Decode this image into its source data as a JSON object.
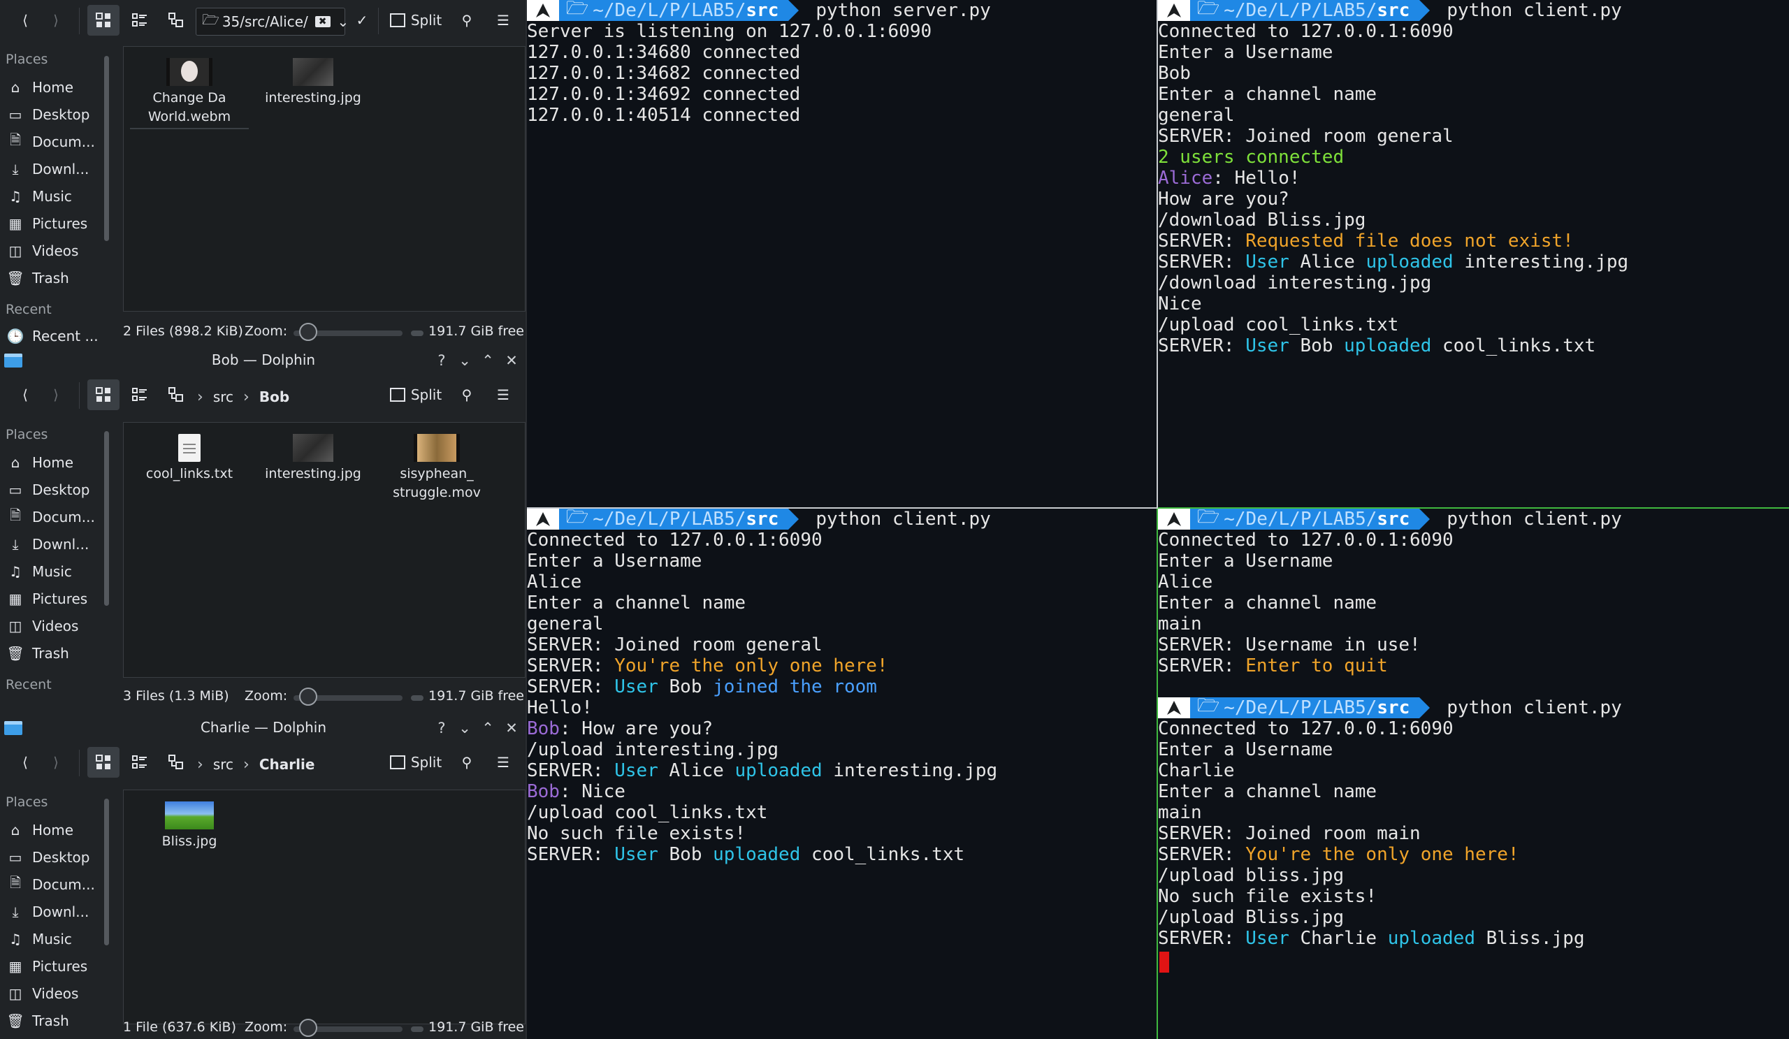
{
  "colors": {
    "terminal_bg": "#0d1117",
    "prompt_blue": "#1f88e5",
    "green": "#7ee03a",
    "purple": "#9b6bd6",
    "orange": "#f0a42a",
    "cyan": "#2fc4e8",
    "blue": "#4aa0ff",
    "cursor_red": "#e01414"
  },
  "alice_window": {
    "url": "35/src/Alice/",
    "split_label": "Split",
    "places_header": "Places",
    "recent_header": "Recent",
    "places": [
      "Home",
      "Desktop",
      "Docum...",
      "Downl...",
      "Music",
      "Pictures",
      "Videos",
      "Trash"
    ],
    "recent": [
      "Recent ..."
    ],
    "files": [
      {
        "name": "Change Da World.webm",
        "icon": "video-thumbnail"
      },
      {
        "name": "interesting.jpg",
        "icon": "image-thumbnail"
      }
    ],
    "status": {
      "count": "2 Files (898.2 KiB)",
      "zoom_label": "Zoom:",
      "free": "191.7 GiB free"
    }
  },
  "bob_window": {
    "title": "Bob — Dolphin",
    "split_label": "Split",
    "breadcrumb": [
      "src",
      "Bob"
    ],
    "places_header": "Places",
    "recent_header": "Recent",
    "places": [
      "Home",
      "Desktop",
      "Docum...",
      "Downl...",
      "Music",
      "Pictures",
      "Videos",
      "Trash"
    ],
    "files": [
      {
        "name": "cool_links.txt",
        "icon": "text-file-icon"
      },
      {
        "name": "interesting.jpg",
        "icon": "image-thumbnail"
      },
      {
        "name": "sisyphean_ struggle.mov",
        "icon": "video-thumbnail"
      }
    ],
    "status": {
      "count": "3 Files (1.3 MiB)",
      "zoom_label": "Zoom:",
      "free": "191.7 GiB free"
    }
  },
  "charlie_window": {
    "title": "Charlie — Dolphin",
    "split_label": "Split",
    "breadcrumb": [
      "src",
      "Charlie"
    ],
    "places_header": "Places",
    "places": [
      "Home",
      "Desktop",
      "Docum...",
      "Downl...",
      "Music",
      "Pictures",
      "Videos",
      "Trash"
    ],
    "files": [
      {
        "name": "Bliss.jpg",
        "icon": "image-thumbnail"
      }
    ],
    "status": {
      "count": "1 File (637.6 KiB)",
      "zoom_label": "Zoom:",
      "free": "191.7 GiB free"
    }
  },
  "prompt": {
    "arch": "arch-linux-icon",
    "folder": "folder-icon",
    "path_dim": "~/De/L/P/LAB5/",
    "path_bold": "src"
  },
  "terminals": {
    "server": {
      "command": "python server.py",
      "lines": [
        [
          {
            "t": "Server is listening on 127.0.0.1:6090"
          }
        ],
        [
          {
            "t": "127.0.0.1:34680 connected"
          }
        ],
        [
          {
            "t": "127.0.0.1:34682 connected"
          }
        ],
        [
          {
            "t": "127.0.0.1:34692 connected"
          }
        ],
        [
          {
            "t": "127.0.0.1:40514 connected"
          }
        ]
      ]
    },
    "bob": {
      "command": "python client.py",
      "lines": [
        [
          {
            "t": "Connected to 127.0.0.1:6090"
          }
        ],
        [
          {
            "t": "Enter a Username"
          }
        ],
        [
          {
            "t": "Bob"
          }
        ],
        [
          {
            "t": "Enter a channel name"
          }
        ],
        [
          {
            "t": "general"
          }
        ],
        [
          {
            "t": "SERVER: Joined room general"
          }
        ],
        [
          {
            "t": "2 users connected",
            "c": "green"
          }
        ],
        [
          {
            "t": "Alice",
            "c": "purple"
          },
          {
            "t": ": Hello!"
          }
        ],
        [
          {
            "t": "How are you?"
          }
        ],
        [
          {
            "t": "/download Bliss.jpg"
          }
        ],
        [
          {
            "t": "SERVER: "
          },
          {
            "t": "Requested file does not exist!",
            "c": "orange"
          }
        ],
        [
          {
            "t": "SERVER: "
          },
          {
            "t": "User",
            "c": "cyan"
          },
          {
            "t": " Alice "
          },
          {
            "t": "uploaded",
            "c": "cyan"
          },
          {
            "t": " interesting.jpg"
          }
        ],
        [
          {
            "t": "/download interesting.jpg"
          }
        ],
        [
          {
            "t": "Nice"
          }
        ],
        [
          {
            "t": "/upload cool_links.txt"
          }
        ],
        [
          {
            "t": "SERVER: "
          },
          {
            "t": "User",
            "c": "cyan"
          },
          {
            "t": " Bob "
          },
          {
            "t": "uploaded",
            "c": "cyan"
          },
          {
            "t": " cool_links.txt"
          }
        ]
      ]
    },
    "alice": {
      "command": "python client.py",
      "lines": [
        [
          {
            "t": "Connected to 127.0.0.1:6090"
          }
        ],
        [
          {
            "t": "Enter a Username"
          }
        ],
        [
          {
            "t": "Alice"
          }
        ],
        [
          {
            "t": "Enter a channel name"
          }
        ],
        [
          {
            "t": "general"
          }
        ],
        [
          {
            "t": "SERVER: Joined room general"
          }
        ],
        [
          {
            "t": "SERVER: "
          },
          {
            "t": "You're the only one here!",
            "c": "orange"
          }
        ],
        [
          {
            "t": "SERVER: "
          },
          {
            "t": "User",
            "c": "cyan"
          },
          {
            "t": " Bob "
          },
          {
            "t": "joined the room",
            "c": "blue"
          }
        ],
        [
          {
            "t": "Hello!"
          }
        ],
        [
          {
            "t": "Bob",
            "c": "purple"
          },
          {
            "t": ": How are you?"
          }
        ],
        [
          {
            "t": "/upload interesting.jpg"
          }
        ],
        [
          {
            "t": "SERVER: "
          },
          {
            "t": "User",
            "c": "cyan"
          },
          {
            "t": " Alice "
          },
          {
            "t": "uploaded",
            "c": "cyan"
          },
          {
            "t": " interesting.jpg"
          }
        ],
        [
          {
            "t": "Bob",
            "c": "purple"
          },
          {
            "t": ": Nice"
          }
        ],
        [
          {
            "t": "/upload cool_links.txt"
          }
        ],
        [
          {
            "t": "No such file exists!"
          }
        ],
        [
          {
            "t": "SERVER: "
          },
          {
            "t": "User",
            "c": "cyan"
          },
          {
            "t": " Bob "
          },
          {
            "t": "uploaded",
            "c": "cyan"
          },
          {
            "t": " cool_links.txt"
          }
        ]
      ]
    },
    "alice2": {
      "command": "python client.py",
      "lines": [
        [
          {
            "t": "Connected to 127.0.0.1:6090"
          }
        ],
        [
          {
            "t": "Enter a Username"
          }
        ],
        [
          {
            "t": "Alice"
          }
        ],
        [
          {
            "t": "Enter a channel name"
          }
        ],
        [
          {
            "t": "main"
          }
        ],
        [
          {
            "t": "SERVER: Username in use!"
          }
        ],
        [
          {
            "t": "SERVER: "
          },
          {
            "t": "Enter to quit",
            "c": "orange"
          }
        ]
      ]
    },
    "charlie": {
      "command": "python client.py",
      "lines": [
        [
          {
            "t": "Connected to 127.0.0.1:6090"
          }
        ],
        [
          {
            "t": "Enter a Username"
          }
        ],
        [
          {
            "t": "Charlie"
          }
        ],
        [
          {
            "t": "Enter a channel name"
          }
        ],
        [
          {
            "t": "main"
          }
        ],
        [
          {
            "t": "SERVER: Joined room main"
          }
        ],
        [
          {
            "t": "SERVER: "
          },
          {
            "t": "You're the only one here!",
            "c": "orange"
          }
        ],
        [
          {
            "t": "/upload bliss.jpg"
          }
        ],
        [
          {
            "t": "No such file exists!"
          }
        ],
        [
          {
            "t": "/upload Bliss.jpg"
          }
        ],
        [
          {
            "t": "SERVER: "
          },
          {
            "t": "User",
            "c": "cyan"
          },
          {
            "t": " Charlie "
          },
          {
            "t": "uploaded",
            "c": "cyan"
          },
          {
            "t": " Bliss.jpg"
          }
        ]
      ]
    }
  }
}
